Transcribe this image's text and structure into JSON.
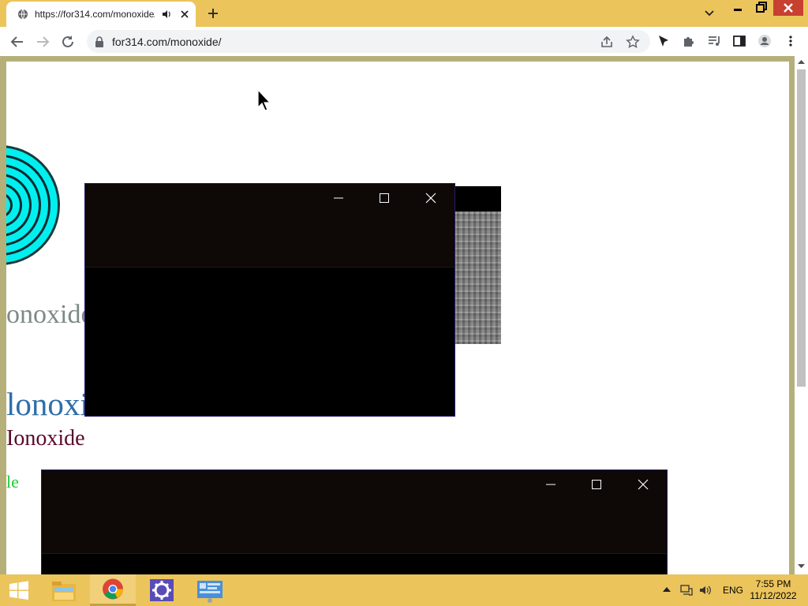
{
  "browser": {
    "tab": {
      "title": "https://for314.com/monoxide/"
    },
    "address": {
      "url": "for314.com/monoxide/"
    }
  },
  "page": {
    "texts": {
      "gray": "onoxide",
      "blue": "lonoxide",
      "red": "Ionoxide",
      "green": "le"
    }
  },
  "taskbar": {
    "language": "ENG",
    "time": "7:55 PM",
    "date": "11/12/2022"
  },
  "colors": {
    "chrome_accent": "#ecc45c",
    "close_button": "#c8402f",
    "circle_fill": "#00f0f0",
    "page_border": "#b5b07a"
  }
}
